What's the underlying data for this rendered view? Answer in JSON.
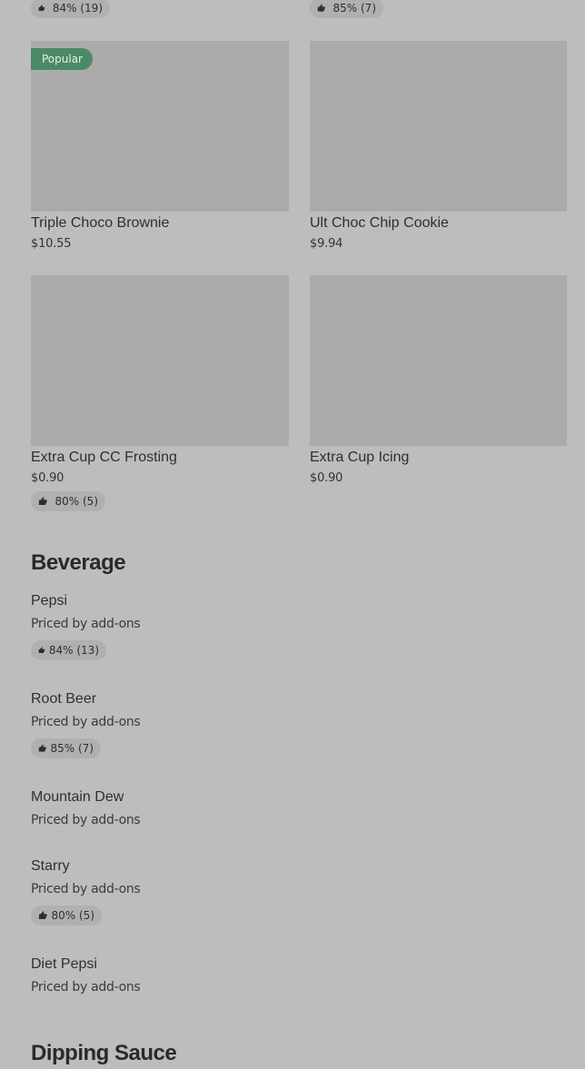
{
  "top_badges": [
    {
      "label": "84% (19)"
    },
    {
      "label": "85% (7)"
    }
  ],
  "cards": [
    {
      "name": " Triple Choco Brownie",
      "price": "$10.55",
      "tag": "Popular"
    },
    {
      "name": " Ult Choc Chip Cookie",
      "price": "$9.94"
    },
    {
      "name": "Extra Cup CC Frosting",
      "price": "$0.90",
      "rating": "80% (5)"
    },
    {
      "name": "Extra Cup Icing",
      "price": "$0.90"
    }
  ],
  "sections": {
    "beverage": {
      "title": "Beverage",
      "items": [
        {
          "name": "Pepsi",
          "sub": "Priced by add-ons",
          "rating": "84% (13)"
        },
        {
          "name": "Root Beer",
          "sub": "Priced by add-ons",
          "rating": "85% (7)"
        },
        {
          "name": "Mountain Dew",
          "sub": "Priced by add-ons"
        },
        {
          "name": "Starry",
          "sub": "Priced by add-ons",
          "rating": "80% (5)"
        },
        {
          "name": "Diet Pepsi",
          "sub": "Priced by add-ons"
        }
      ]
    },
    "dipping": {
      "title": "Dipping Sauce"
    }
  },
  "icons": {
    "thumb": "thumbs-up-icon"
  }
}
